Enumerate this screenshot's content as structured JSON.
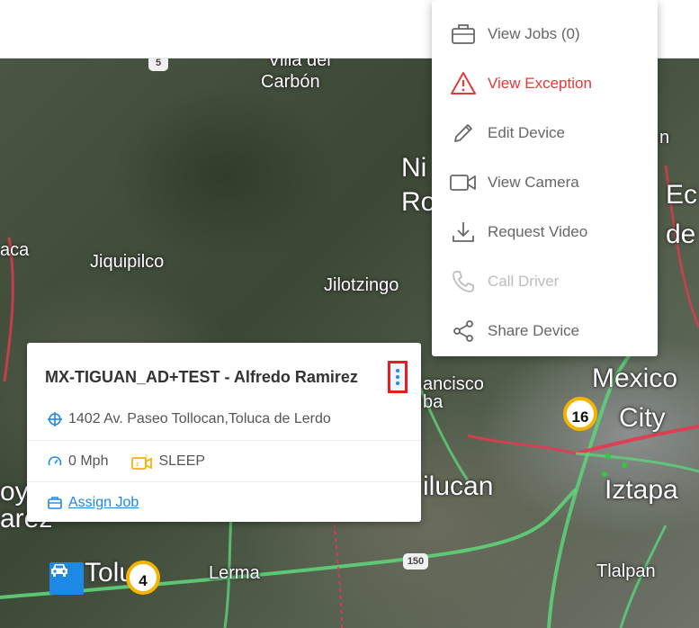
{
  "map": {
    "labels": {
      "villa_del": "Villa del",
      "carbon": "Carbón",
      "jiquipilco": "Jiquipilco",
      "jilotzingo": "Jilotzingo",
      "ni": "Ni",
      "ro": "Ro",
      "aca": "aca",
      "ec": "Ec",
      "de": "de",
      "mexico": "Mexico",
      "city": "City",
      "iztapa": "Iztapa",
      "tlalpan": "Tlalpan",
      "lerma": "Lerma",
      "toluc": "Toluc",
      "ilucan": "ilucan",
      "ancisco": "ancisco",
      "ba": "ba",
      "oy": "oy",
      "arez": "arez",
      "n": "n"
    },
    "road_shields": {
      "shield_top": "5",
      "shield_bottom": "150"
    },
    "clusters": {
      "cluster_city": "16",
      "cluster_toluca": "4"
    }
  },
  "card": {
    "title": "MX-TIGUAN_AD+TEST - Alfredo Ramirez",
    "address": "1402 Av. Paseo Tollocan,Toluca de Lerdo",
    "speed": "0 Mph",
    "camera_status": "SLEEP",
    "assign_job_label": "Assign Job"
  },
  "menu": {
    "items": [
      {
        "label": "View Jobs (0)",
        "icon": "briefcase-icon"
      },
      {
        "label": "View Exception",
        "icon": "warning-icon"
      },
      {
        "label": "Edit Device",
        "icon": "pencil-icon"
      },
      {
        "label": "View Camera",
        "icon": "video-camera-icon"
      },
      {
        "label": "Request Video",
        "icon": "download-icon"
      },
      {
        "label": "Call Driver",
        "icon": "phone-icon"
      },
      {
        "label": "Share Device",
        "icon": "share-icon"
      }
    ]
  },
  "colors": {
    "accent": "#1e88e5",
    "danger": "#e53935",
    "disabled": "#bdbdbd",
    "cluster_ring": "#f4b400",
    "traffic_green": "#5ed37a",
    "traffic_red": "#e53950"
  }
}
